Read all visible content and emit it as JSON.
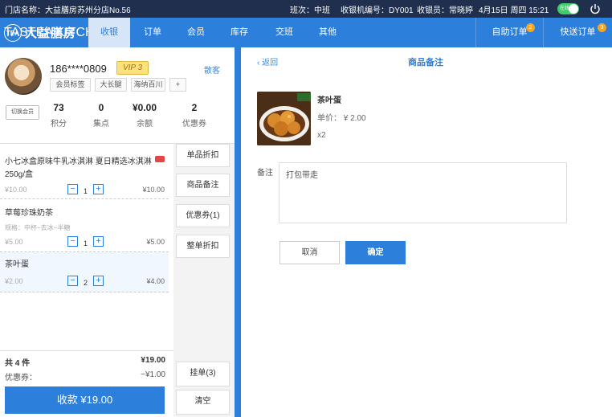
{
  "topbar": {
    "store": "门店名称：大益膳房苏州分店No.56",
    "shift": "班次：中班",
    "machine": "收银机编号：DY001",
    "cashier": "收银员：常晓婷",
    "datetime": "4月15日  周四  15:21",
    "online_label": "在线",
    "icons": {
      "power": "power-icon"
    }
  },
  "brand": {
    "name": "大益膳房",
    "sub": "TASTEA KITCHEN",
    "mark": "TEA"
  },
  "nav": {
    "tabs": [
      {
        "label": "收银",
        "active": true
      },
      {
        "label": "订单",
        "active": false
      },
      {
        "label": "会员",
        "active": false
      },
      {
        "label": "库存",
        "active": false
      },
      {
        "label": "交班",
        "active": false
      },
      {
        "label": "其他",
        "active": false
      }
    ],
    "right": [
      {
        "label": "自助订单",
        "badge": "2"
      },
      {
        "label": "快送订单",
        "badge": "3"
      }
    ]
  },
  "member": {
    "phone": "186****0809",
    "vip": "VIP 3",
    "guest_link": "散客",
    "tags": [
      "会员标签",
      "大长腿",
      "海纳百川",
      "+"
    ],
    "switch_label": "切换会员",
    "stats": [
      {
        "value": "73",
        "label": "积分"
      },
      {
        "value": "0",
        "label": "集点"
      },
      {
        "value": "¥0.00",
        "label": "余额"
      },
      {
        "value": "2",
        "label": "优惠券"
      }
    ]
  },
  "cart": {
    "items": [
      {
        "name": "小七冰盒原味牛乳冰淇淋  夏日精选冰淇淋  250g/盒",
        "spec": "",
        "price": "¥10.00",
        "qty": "1",
        "total": "¥10.00"
      },
      {
        "name": "草莓珍珠奶茶",
        "spec": "规格：中杯−去冰−半糖",
        "price": "¥5.00",
        "qty": "1",
        "total": "¥5.00"
      },
      {
        "name": "茶叶蛋",
        "spec": "",
        "price": "¥2.00",
        "qty": "2",
        "total": "¥4.00"
      }
    ],
    "side_buttons": [
      "单品折扣",
      "商品备注",
      "优惠券(1)",
      "整单折扣"
    ],
    "bottom_buttons": [
      "挂单(3)",
      "清空"
    ],
    "summary_count": "共 4 件",
    "summary_total": "¥19.00",
    "coupon_label": "优惠券：",
    "coupon_value": "−¥1.00",
    "checkout": "收款  ¥19.00"
  },
  "remark_panel": {
    "back": "返回",
    "title": "商品备注",
    "product_name": "茶叶蛋",
    "unit_price": "单价： ¥ 2.00",
    "qty": "x2",
    "remark_label": "备注",
    "remark_value": "打包带走",
    "cancel": "取消",
    "confirm": "确定"
  },
  "colors": {
    "primary": "#2d7fdc",
    "topbar": "#1f2f4d",
    "badge": "#f5a623",
    "online": "#3fcc6a"
  }
}
